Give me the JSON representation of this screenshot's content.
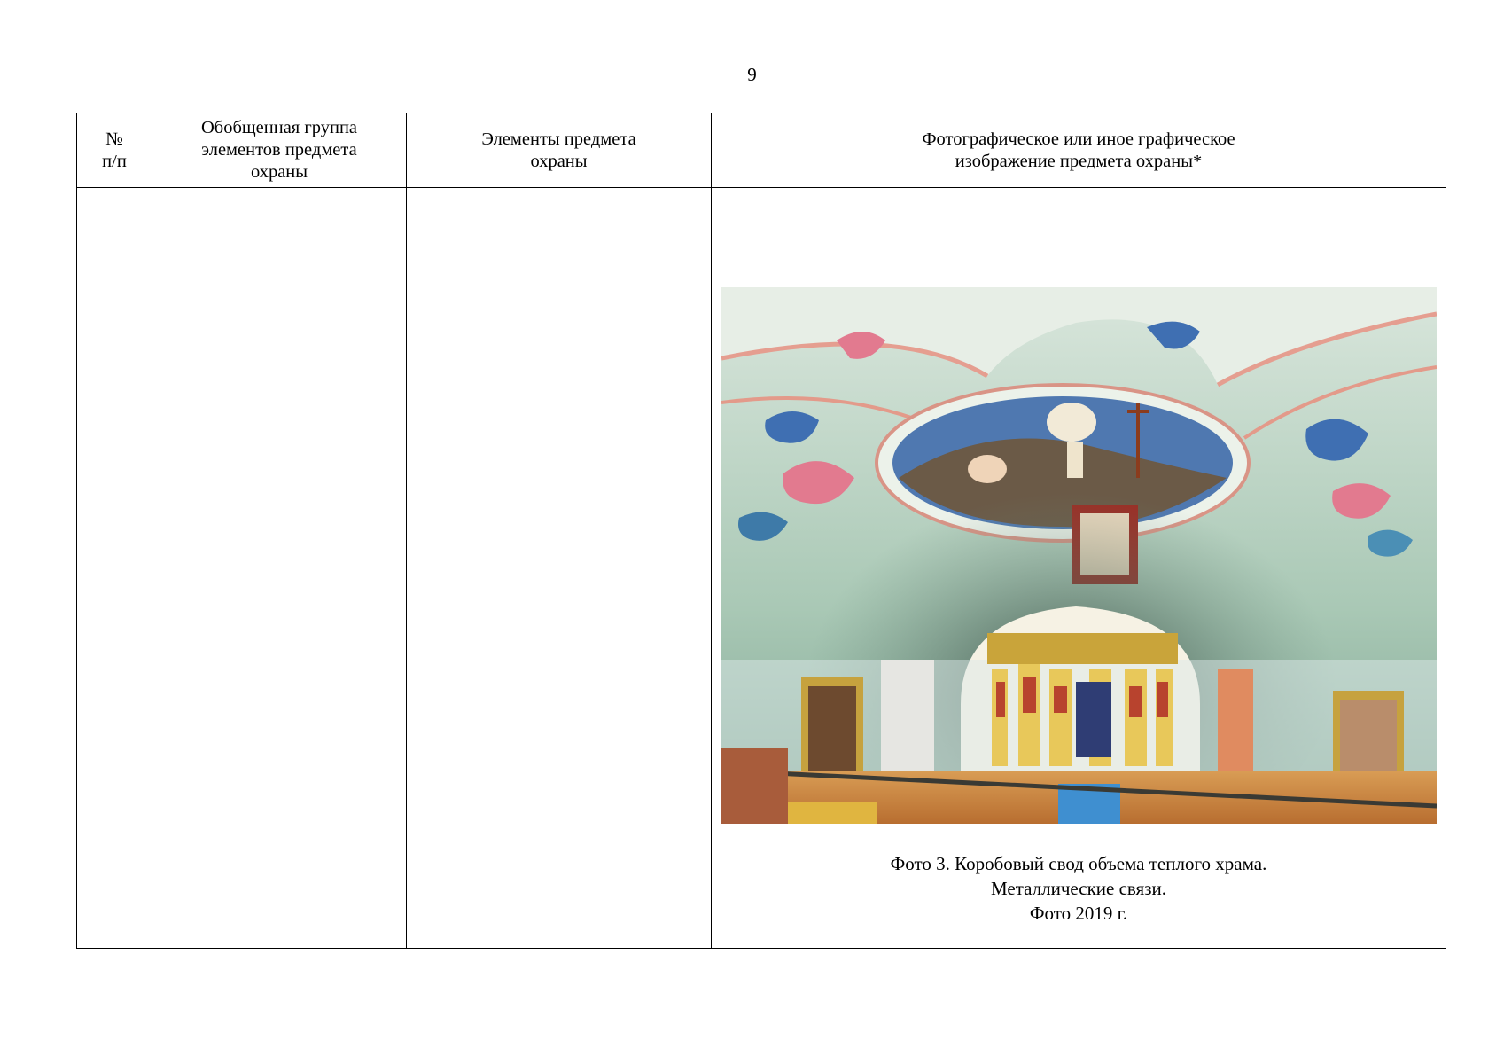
{
  "page": {
    "number": "9"
  },
  "table": {
    "headers": [
      "№\nп/п",
      "Обобщенная группа элементов предмета охраны",
      "Элементы предмета охраны",
      "Фотографическое или иное графическое изображение предмета охраны*"
    ],
    "rows": [
      {
        "number": "",
        "group": "",
        "elements": ""
      }
    ]
  },
  "photo": {
    "subject": "church-interior-vault-photo",
    "caption_lines": [
      "Фото 3. Коробовый свод объема теплого храма.",
      "Металлические связи.",
      "Фото 2019 г."
    ]
  }
}
